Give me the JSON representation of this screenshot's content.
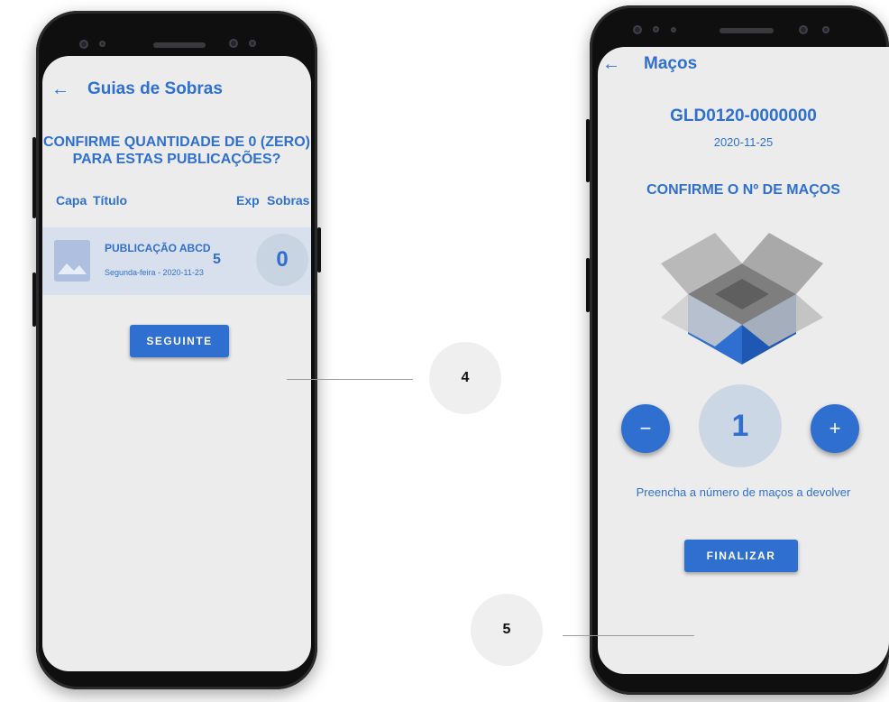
{
  "screen_left": {
    "title": "Guias de Sobras",
    "back_icon": "arrow-left-icon",
    "prompt": "CONFIRME QUANTIDADE DE 0 (ZERO)\nPARA ESTAS PUBLICAÇÕES?",
    "columns": [
      "Capa",
      "Título",
      "Exp",
      "Sobras"
    ],
    "rows": [
      {
        "cover_icon": "image-placeholder-icon",
        "title": "PUBLICAÇÃO ABCD",
        "subtitle": "Segunda-feira - 2020-11-23",
        "exp": "5",
        "sobras": "0"
      }
    ],
    "next_button": "SEGUINTE"
  },
  "screen_right": {
    "title": "Maços",
    "back_icon": "arrow-left-icon",
    "reference": "GLD0120-0000000",
    "date": "2020-11-25",
    "prompt": "CONFIRME O Nº DE MAÇOS",
    "illustration": "open-box-icon",
    "minus_label": "−",
    "plus_label": "+",
    "count": "1",
    "hint": "Preencha a número de maços a devolver",
    "finish_button": "FINALIZAR"
  },
  "callouts": [
    "4",
    "5"
  ],
  "colors": {
    "accent": "#2f6fcf",
    "screen_bg": "#ececec",
    "row_highlight": "#d7e0ec",
    "circle_bg": "#ccd7e5"
  }
}
